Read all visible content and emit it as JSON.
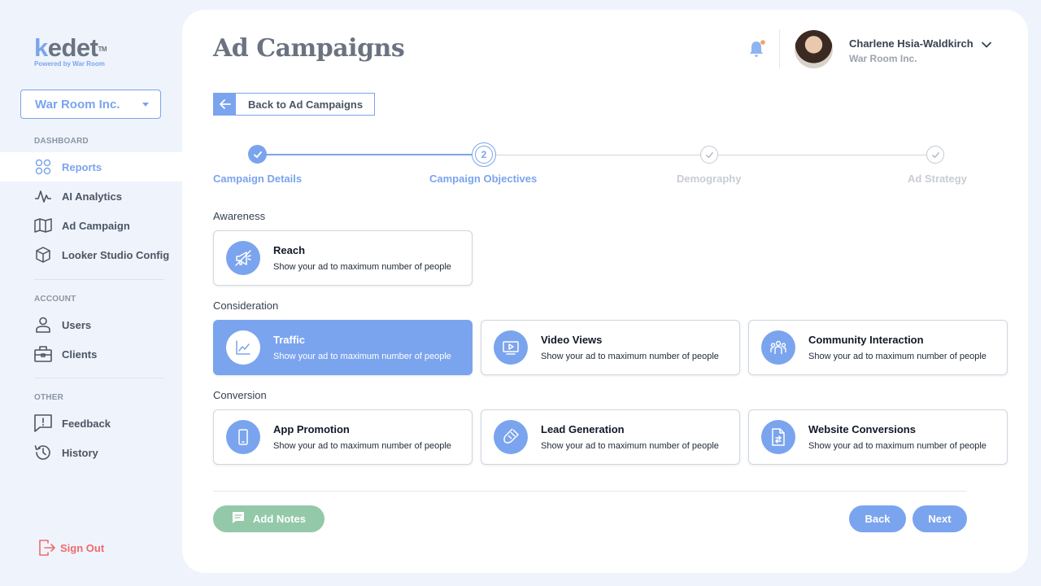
{
  "brand": {
    "logo_k": "k",
    "logo_rest": "edet",
    "logo_tm": "TM",
    "tagline": "Powered by War Room"
  },
  "org_selector": {
    "value": "War Room Inc."
  },
  "sidebar": {
    "sections": [
      {
        "title": "DASHBOARD",
        "items": [
          {
            "label": "Reports",
            "icon": "grid-icon",
            "active": true
          },
          {
            "label": "AI Analytics",
            "icon": "activity-icon"
          },
          {
            "label": "Ad Campaign",
            "icon": "map-icon"
          },
          {
            "label": "Looker Studio Config",
            "icon": "cube-icon"
          }
        ]
      },
      {
        "title": "ACCOUNT",
        "items": [
          {
            "label": "Users",
            "icon": "user-icon"
          },
          {
            "label": "Clients",
            "icon": "briefcase-icon"
          }
        ]
      },
      {
        "title": "OTHER",
        "items": [
          {
            "label": "Feedback",
            "icon": "feedback-icon"
          },
          {
            "label": "History",
            "icon": "history-icon"
          }
        ]
      }
    ],
    "signout": "Sign Out"
  },
  "header": {
    "title": "Ad Campaigns",
    "user": {
      "name": "Charlene Hsia-Waldkirch",
      "org": "War Room Inc."
    }
  },
  "back_button": {
    "label": "Back to Ad Campaigns"
  },
  "stepper": {
    "steps": [
      {
        "label": "Campaign Details",
        "state": "done"
      },
      {
        "label": "Campaign Objectives",
        "state": "current",
        "number": "2"
      },
      {
        "label": "Demography",
        "state": "pending"
      },
      {
        "label": "Ad Strategy",
        "state": "pending"
      }
    ]
  },
  "groups": [
    {
      "title": "Awareness",
      "cards": [
        {
          "title": "Reach",
          "desc": "Show your ad to maximum number of people",
          "icon": "megaphone-icon"
        }
      ]
    },
    {
      "title": "Consideration",
      "cards": [
        {
          "title": "Traffic",
          "desc": "Show your ad to maximum number of people",
          "icon": "chart-icon",
          "selected": true
        },
        {
          "title": "Video Views",
          "desc": "Show your ad to maximum number of people",
          "icon": "video-icon"
        },
        {
          "title": "Community Interaction",
          "desc": "Show your ad to maximum number of people",
          "icon": "community-icon"
        }
      ]
    },
    {
      "title": "Conversion",
      "cards": [
        {
          "title": "App Promotion",
          "desc": "Show your ad to maximum number of people",
          "icon": "phone-icon"
        },
        {
          "title": "Lead Generation",
          "desc": "Show your ad to maximum number of people",
          "icon": "magnet-icon"
        },
        {
          "title": "Website Conversions",
          "desc": "Show your ad to maximum number of people",
          "icon": "web-conversion-icon"
        }
      ]
    }
  ],
  "footer": {
    "notes": "Add Notes",
    "back": "Back",
    "next": "Next"
  },
  "colors": {
    "accent": "#7ba4ee",
    "success": "#93c9a8",
    "danger": "#ef6b6b",
    "bg": "#eff4fc"
  }
}
